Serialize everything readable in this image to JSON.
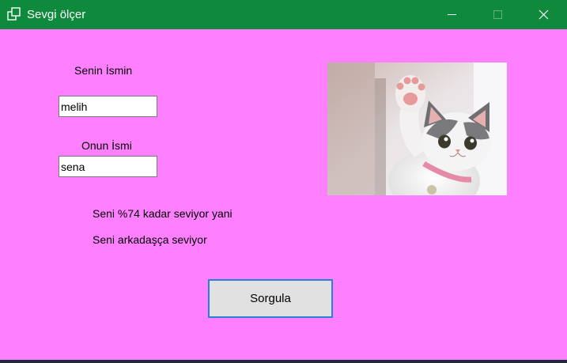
{
  "window": {
    "title": "Sevgi ölçer",
    "titlebar_color": "#0f8a3c",
    "background_color": "#ff80ff",
    "controls": {
      "minimize_icon": "minimize-icon",
      "maximize_icon": "maximize-icon",
      "close_icon": "close-icon"
    }
  },
  "form": {
    "your_name_label": "Senin İsmin",
    "your_name_value": "melih",
    "their_name_label": "Onun İsmi",
    "their_name_value": "sena",
    "result_percent_text": "Seni %74 kadar seviyor yani",
    "result_verdict_text": "Seni arkadaşça seviyor",
    "query_button_label": "Sorgula",
    "query_button_border_color": "#2b7fd8",
    "picture_icon": "kitten-waving-photo"
  }
}
